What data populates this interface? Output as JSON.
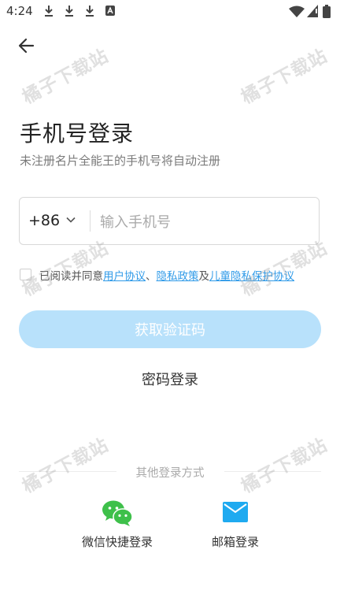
{
  "status_bar": {
    "time": "4:24",
    "download_icon_count": 3
  },
  "header": {
    "title": "手机号登录",
    "subtitle": "未注册名片全能王的手机号将自动注册"
  },
  "phone": {
    "country_code": "+86",
    "placeholder": "输入手机号",
    "value": ""
  },
  "agreement": {
    "checked": false,
    "prefix": "已阅读并同意",
    "user_agreement": "用户协议",
    "sep1": "、",
    "privacy_policy": "隐私政策",
    "sep2": "及",
    "child_privacy": "儿童隐私保护协议"
  },
  "buttons": {
    "get_code": "获取验证码",
    "password_login": "密码登录"
  },
  "other_login": {
    "title": "其他登录方式",
    "wechat_label": "微信快捷登录",
    "email_label": "邮箱登录"
  },
  "watermark": "橘子下载站",
  "colors": {
    "accent": "#2f9ae8",
    "button_disabled": "#b8e1fb",
    "wechat": "#3ec04a",
    "mail": "#1faaf0"
  }
}
